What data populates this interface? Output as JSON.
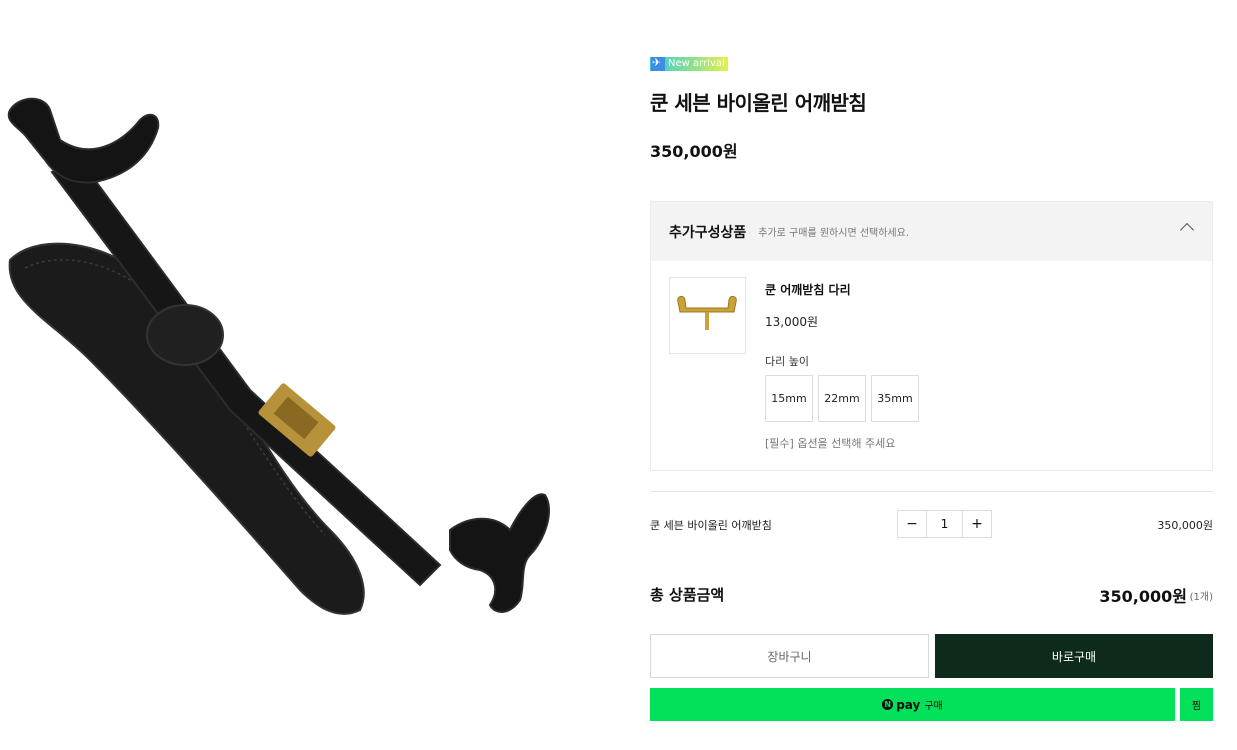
{
  "badge": {
    "icon": "airplane-icon",
    "text": "New arrival"
  },
  "product": {
    "title": "쿤 세븐 바이올린 어깨받침",
    "price": "350,000원"
  },
  "addon": {
    "heading": "추가구성상품",
    "subtext": "추가로 구매를 원하시면 선택하세요.",
    "item": {
      "name": "쿤 어깨받침 다리",
      "price": "13,000원",
      "option_label": "다리 높이",
      "options": [
        "15mm",
        "22mm",
        "35mm"
      ],
      "required_note": "[필수] 옵션을 선택해 주세요"
    }
  },
  "line_item": {
    "name": "쿤 세븐 바이올린 어깨받침",
    "quantity": "1",
    "minus": "−",
    "plus": "+",
    "price": "350,000원"
  },
  "total": {
    "label": "총 상품금액",
    "amount": "350,000원",
    "count": "(1개)"
  },
  "buttons": {
    "cart": "장바구니",
    "buy": "바로구매",
    "npay_n": "N",
    "npay_pay": "pay",
    "npay_buy": "구매",
    "wish": "찜"
  },
  "colors": {
    "buy_button": "#0e2a1b",
    "npay_green": "#03e05a"
  }
}
